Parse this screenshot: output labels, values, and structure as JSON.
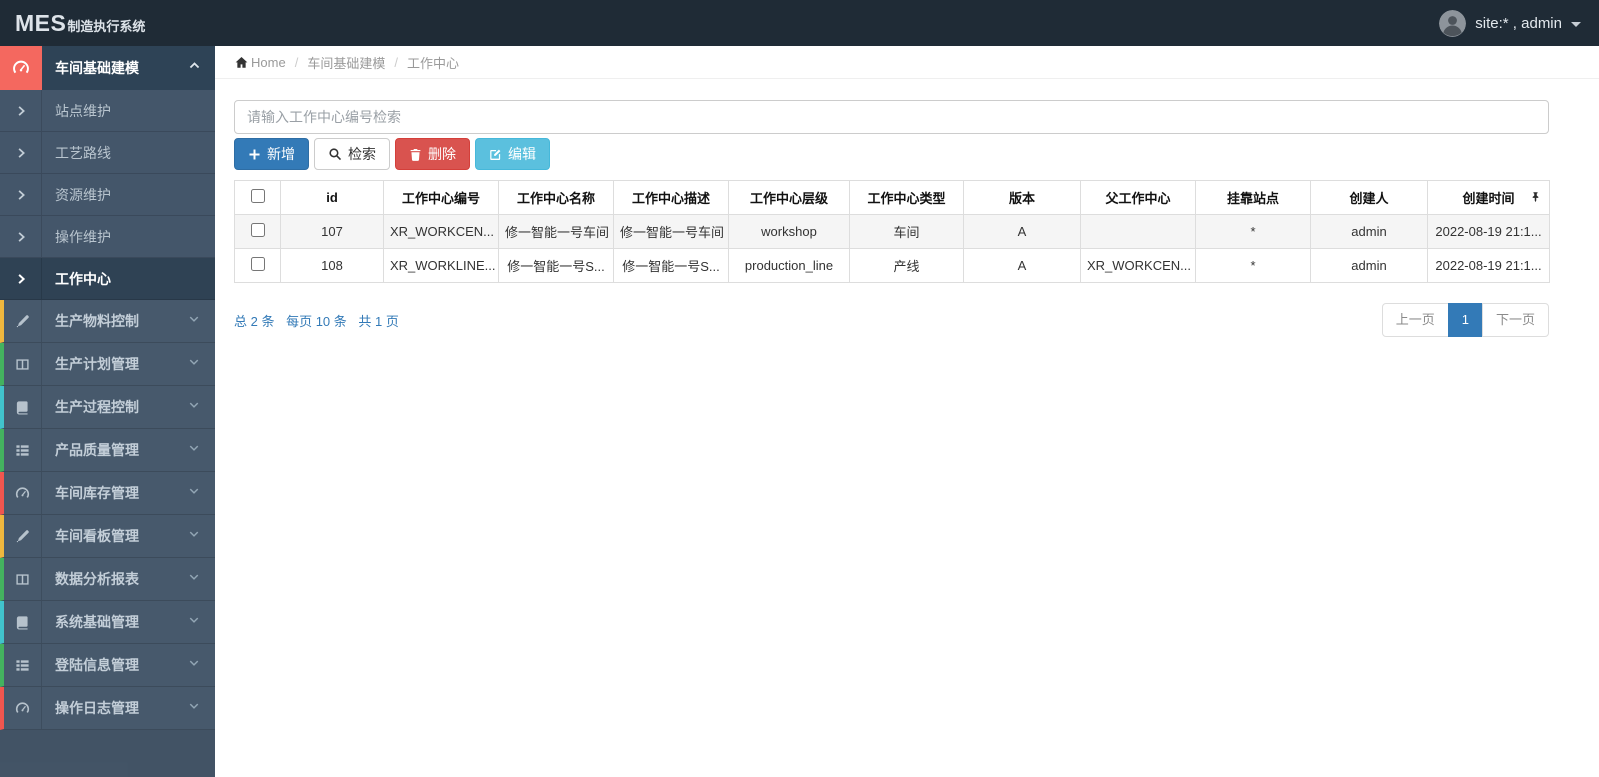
{
  "app": {
    "brand_bold": "MES",
    "brand_rest": "制造执行系统",
    "user": "site:* , admin"
  },
  "theme": {
    "navbar_bg": "#1f2b36",
    "sidebar_bg": "#47596c",
    "active_item_bg": "#2f4254",
    "active_icon_bg": "#f4685f",
    "primary": "#337ab7",
    "danger": "#d9534f",
    "info": "#5bc0de",
    "link_blue": "#337ab7",
    "table_border": "#ddd",
    "stripe": "#f5f5f5"
  },
  "breadcrumb": {
    "home": "Home",
    "separator": "/",
    "items": [
      "车间基础建模",
      "工作中心"
    ]
  },
  "sidebar": {
    "parent": {
      "label": "车间基础建模",
      "icon": "gauge-icon"
    },
    "subitems": [
      {
        "label": "站点维护"
      },
      {
        "label": "工艺路线"
      },
      {
        "label": "资源维护"
      },
      {
        "label": "操作维护"
      },
      {
        "label": "工作中心",
        "active": true
      }
    ],
    "items": [
      {
        "label": "生产物料控制",
        "icon": "pencil-icon",
        "strip": "#efb73e"
      },
      {
        "label": "生产计划管理",
        "icon": "columns-icon",
        "strip": "#44b25f"
      },
      {
        "label": "生产过程控制",
        "icon": "book-icon",
        "strip": "#41c3cc"
      },
      {
        "label": "产品质量管理",
        "icon": "list-icon",
        "strip": "#44b25f"
      },
      {
        "label": "车间库存管理",
        "icon": "gauge-icon",
        "strip": "#f1564f"
      },
      {
        "label": "车间看板管理",
        "icon": "pencil-icon",
        "strip": "#efb73e"
      },
      {
        "label": "数据分析报表",
        "icon": "columns-icon",
        "strip": "#44b25f"
      },
      {
        "label": "系统基础管理",
        "icon": "book-icon",
        "strip": "#41c3cc"
      },
      {
        "label": "登陆信息管理",
        "icon": "list-icon",
        "strip": "#44b25f"
      },
      {
        "label": "操作日志管理",
        "icon": "gauge-icon",
        "strip": "#f1564f"
      }
    ]
  },
  "toolbar": {
    "search_placeholder": "请输入工作中心编号检索",
    "add_label": "新增",
    "search_label": "检索",
    "delete_label": "删除",
    "edit_label": "编辑"
  },
  "table": {
    "headers": [
      "id",
      "工作中心编号",
      "工作中心名称",
      "工作中心描述",
      "工作中心层级",
      "工作中心类型",
      "版本",
      "父工作中心",
      "挂靠站点",
      "创建人",
      "创建时间"
    ],
    "rows": [
      [
        "107",
        "XR_WORKCEN...",
        "修一智能一号车间",
        "修一智能一号车间",
        "workshop",
        "车间",
        "A",
        "",
        "*",
        "admin",
        "2022-08-19 21:1..."
      ],
      [
        "108",
        "XR_WORKLINE...",
        "修一智能一号S...",
        "修一智能一号S...",
        "production_line",
        "产线",
        "A",
        "XR_WORKCEN...",
        "*",
        "admin",
        "2022-08-19 21:1..."
      ]
    ]
  },
  "pagination": {
    "total": "总 2 条",
    "per_page": "每页 10 条",
    "pages": "共 1 页",
    "prev": "上一页",
    "page": "1",
    "next": "下一页"
  }
}
